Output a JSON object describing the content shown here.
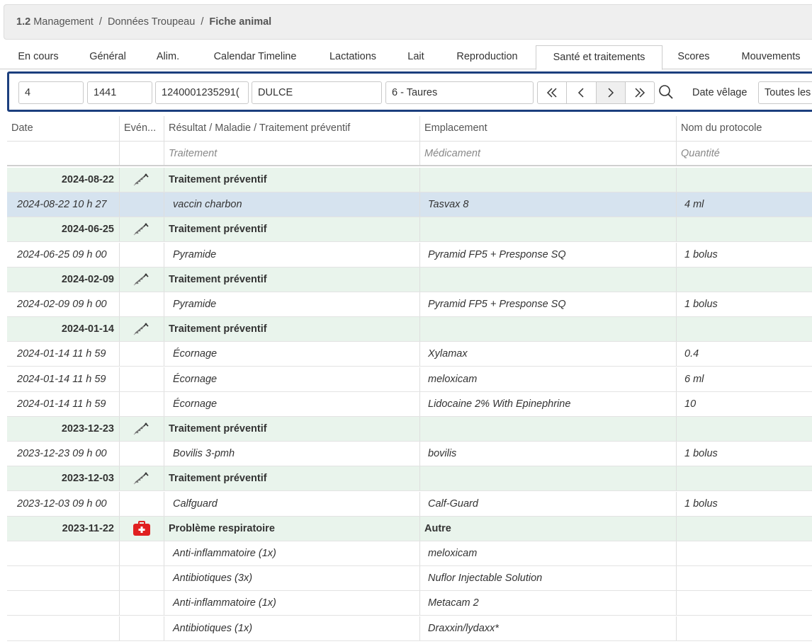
{
  "breadcrumb": {
    "section_number": "1.2",
    "section": "Management",
    "sep1": "/",
    "subsection": "Données Troupeau",
    "sep2": "/",
    "page": "Fiche animal"
  },
  "tabs": [
    {
      "label": "En cours"
    },
    {
      "label": "Général"
    },
    {
      "label": "Alim."
    },
    {
      "label": "Calendar Timeline"
    },
    {
      "label": "Lactations"
    },
    {
      "label": "Lait"
    },
    {
      "label": "Reproduction"
    },
    {
      "label": "Santé et traitements",
      "active": true
    },
    {
      "label": "Scores"
    },
    {
      "label": "Mouvements"
    }
  ],
  "search": {
    "field1": "4",
    "field2": "1441",
    "field3": "1240001235291(",
    "field4": "DULCE",
    "group": "6 - Taures",
    "date_label": "Date vêlage",
    "date_select": "Toutes les"
  },
  "icons": {
    "first": "double-chevron-left-icon",
    "prev": "chevron-left-icon",
    "next": "chevron-right-icon",
    "last": "double-chevron-right-icon",
    "search": "magnifier-icon",
    "syringe": "syringe-icon",
    "medkit": "medical-kit-icon"
  },
  "colors": {
    "accent_border": "#1c3f7e",
    "group_row_bg": "#e9f4ec",
    "selected_row_bg": "#d6e3ef",
    "medkit_red": "#e02020"
  },
  "table": {
    "headers": {
      "date": "Date",
      "event": "Evén...",
      "result": "Résultat / Maladie / Traitement préventif",
      "location": "Emplacement",
      "protocol": "Nom du protocole"
    },
    "subheaders": {
      "treatment": "Traitement",
      "drug": "Médicament",
      "quantity": "Quantité"
    },
    "rows": [
      {
        "kind": "group",
        "date": "2024-08-22",
        "icon": "syringe",
        "result": "Traitement préventif",
        "location": "",
        "protocol": ""
      },
      {
        "kind": "detail",
        "selected": true,
        "date": "2024-08-22 10 h 27",
        "result": "vaccin charbon",
        "location": "Tasvax 8",
        "protocol": "4 ml"
      },
      {
        "kind": "group",
        "date": "2024-06-25",
        "icon": "syringe",
        "result": "Traitement préventif",
        "location": "",
        "protocol": ""
      },
      {
        "kind": "detail",
        "date": "2024-06-25 09 h 00",
        "result": "Pyramide",
        "location": "Pyramid FP5 + Presponse SQ",
        "protocol": "1 bolus"
      },
      {
        "kind": "group",
        "date": "2024-02-09",
        "icon": "syringe",
        "result": "Traitement préventif",
        "location": "",
        "protocol": ""
      },
      {
        "kind": "detail",
        "date": "2024-02-09 09 h 00",
        "result": "Pyramide",
        "location": "Pyramid FP5 + Presponse SQ",
        "protocol": "1 bolus"
      },
      {
        "kind": "group",
        "date": "2024-01-14",
        "icon": "syringe",
        "result": "Traitement préventif",
        "location": "",
        "protocol": ""
      },
      {
        "kind": "detail",
        "date": "2024-01-14 11 h 59",
        "result": "Écornage",
        "location": "Xylamax",
        "protocol": "0.4"
      },
      {
        "kind": "detail",
        "date": "2024-01-14 11 h 59",
        "result": "Écornage",
        "location": "meloxicam",
        "protocol": "6 ml"
      },
      {
        "kind": "detail",
        "date": "2024-01-14 11 h 59",
        "result": "Écornage",
        "location": "Lidocaine 2% With Epinephrine",
        "protocol": "10"
      },
      {
        "kind": "group",
        "date": "2023-12-23",
        "icon": "syringe",
        "result": "Traitement préventif",
        "location": "",
        "protocol": ""
      },
      {
        "kind": "detail",
        "date": "2023-12-23 09 h 00",
        "result": "Bovilis 3-pmh",
        "location": "bovilis",
        "protocol": "1 bolus"
      },
      {
        "kind": "group",
        "date": "2023-12-03",
        "icon": "syringe",
        "result": "Traitement préventif",
        "location": "",
        "protocol": ""
      },
      {
        "kind": "detail",
        "date": "2023-12-03 09 h 00",
        "result": "Calfguard",
        "location": "Calf-Guard",
        "protocol": "1 bolus"
      },
      {
        "kind": "group",
        "date": "2023-11-22",
        "icon": "medkit",
        "result": "Problème respiratoire",
        "location": "Autre",
        "protocol": ""
      },
      {
        "kind": "detail",
        "date": "",
        "result": "Anti-inflammatoire (1x)",
        "location": "meloxicam",
        "protocol": ""
      },
      {
        "kind": "detail",
        "date": "",
        "result": "Antibiotiques (3x)",
        "location": "Nuflor Injectable Solution",
        "protocol": ""
      },
      {
        "kind": "detail",
        "date": "",
        "result": "Anti-inflammatoire (1x)",
        "location": "Metacam 2",
        "protocol": ""
      },
      {
        "kind": "detail",
        "date": "",
        "result": "Antibiotiques (1x)",
        "location": "Draxxin/lydaxx*",
        "protocol": ""
      }
    ]
  }
}
